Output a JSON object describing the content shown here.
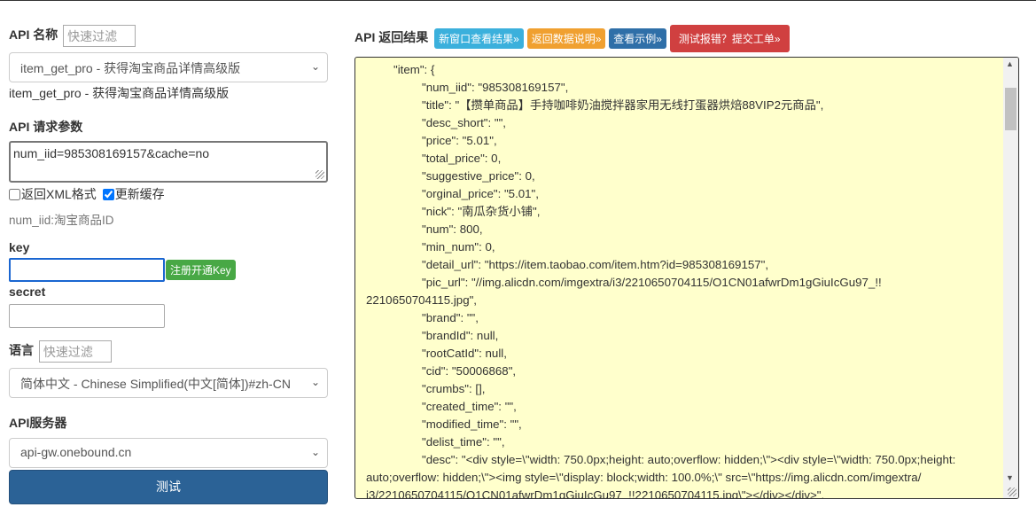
{
  "api_name": {
    "label": "API 名称",
    "filter_placeholder": "快速过滤",
    "selected": "item_get_pro - 获得淘宝商品详情高级版",
    "desc": "item_get_pro - 获得淘宝商品详情高级版"
  },
  "params": {
    "label": "API 请求参数",
    "value": "num_iid=985308169157&cache=no",
    "xml_label": "返回XML格式",
    "cache_label": "更新缓存",
    "hint": "num_iid:淘宝商品ID"
  },
  "key": {
    "label": "key",
    "register_button": "注册开通Key"
  },
  "secret": {
    "label": "secret"
  },
  "lang": {
    "label": "语言",
    "filter_placeholder": "快速过滤",
    "selected": "简体中文 - Chinese Simplified(中文[简体])#zh-CN"
  },
  "server": {
    "label": "API服务器",
    "selected": "api-gw.onebound.cn"
  },
  "test_button": "测试",
  "result": {
    "label": "API 返回结果",
    "buttons": [
      "新窗口查看结果»",
      "返回数据说明»",
      "查看示例»",
      "测试报错？提交工单»"
    ],
    "lines": [
      {
        "i": 1,
        "t": "\"item\": {"
      },
      {
        "i": 2,
        "t": "\"num_iid\": \"985308169157\","
      },
      {
        "i": 2,
        "t": "\"title\": \"【攒单商品】手持咖啡奶油搅拌器家用无线打蛋器烘焙88VIP2元商品\","
      },
      {
        "i": 2,
        "t": "\"desc_short\": \"\","
      },
      {
        "i": 2,
        "t": "\"price\": \"5.01\","
      },
      {
        "i": 2,
        "t": "\"total_price\": 0,"
      },
      {
        "i": 2,
        "t": "\"suggestive_price\": 0,"
      },
      {
        "i": 2,
        "t": "\"orginal_price\": \"5.01\","
      },
      {
        "i": 2,
        "t": "\"nick\": \"南瓜杂货小铺\","
      },
      {
        "i": 2,
        "t": "\"num\": 800,"
      },
      {
        "i": 2,
        "t": "\"min_num\": 0,"
      },
      {
        "i": 2,
        "t": "\"detail_url\": \"https://item.taobao.com/item.htm?id=985308169157\","
      },
      {
        "i": 2,
        "t": "\"pic_url\": \"//img.alicdn.com/imgextra/i3/2210650704115/O1CN01afwrDm1gGiuIcGu97_!!"
      },
      {
        "i": 0,
        "t": "2210650704115.jpg\","
      },
      {
        "i": 2,
        "t": "\"brand\": \"\","
      },
      {
        "i": 2,
        "t": "\"brandId\": null,"
      },
      {
        "i": 2,
        "t": "\"rootCatId\": null,"
      },
      {
        "i": 2,
        "t": "\"cid\": \"50006868\","
      },
      {
        "i": 2,
        "t": "\"crumbs\": [],"
      },
      {
        "i": 2,
        "t": "\"created_time\": \"\","
      },
      {
        "i": 2,
        "t": "\"modified_time\": \"\","
      },
      {
        "i": 2,
        "t": "\"delist_time\": \"\","
      },
      {
        "i": 2,
        "t": "\"desc\": \"<div style=\\\"width: 750.0px;height: auto;overflow: hidden;\\\"><div style=\\\"width: 750.0px;height:"
      },
      {
        "i": 0,
        "t": "auto;overflow: hidden;\\\"><img style=\\\"display: block;width: 100.0%;\\\" src=\\\"https://img.alicdn.com/imgextra/"
      },
      {
        "i": 0,
        "t": "i3/2210650704115/O1CN01afwrDm1gGiuIcGu97_!!2210650704115.jpg\\\"></div></div>\","
      }
    ]
  },
  "colors": {
    "btn1": "#3bb0dc",
    "btn2": "#f0a030",
    "btn3": "#2f6fa8",
    "btn4": "#d04040",
    "green": "#48a845",
    "primary": "#2b6296"
  }
}
